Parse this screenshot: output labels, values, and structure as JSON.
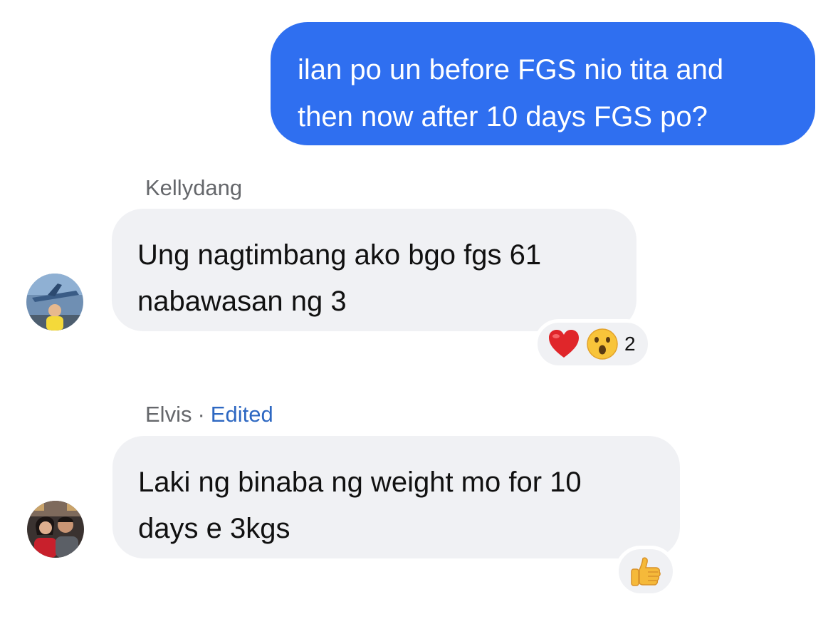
{
  "outgoing_message": {
    "line1": "ilan po un before FGS nio tita and",
    "line2": "then now after 10 days FGS po?"
  },
  "messages": [
    {
      "sender": "Kellydang",
      "line1": "Ung nagtimbang ako bgo fgs 61",
      "line2": "nabawasan ng 3",
      "reactions": [
        "heart-icon",
        "surprised-face-icon"
      ],
      "reaction_count": "2"
    },
    {
      "sender": "Elvis",
      "separator": "·",
      "edited_label": "Edited",
      "line1": "Laki ng binaba ng weight mo for 10",
      "line2": "days e 3kgs",
      "reactions": [
        "thumbs-up-icon"
      ]
    }
  ],
  "colors": {
    "outgoing_bubble": "#2f6ff0",
    "incoming_bubble": "#f0f1f4",
    "edited_link": "#2e68c2",
    "sender_name": "#65676b"
  }
}
